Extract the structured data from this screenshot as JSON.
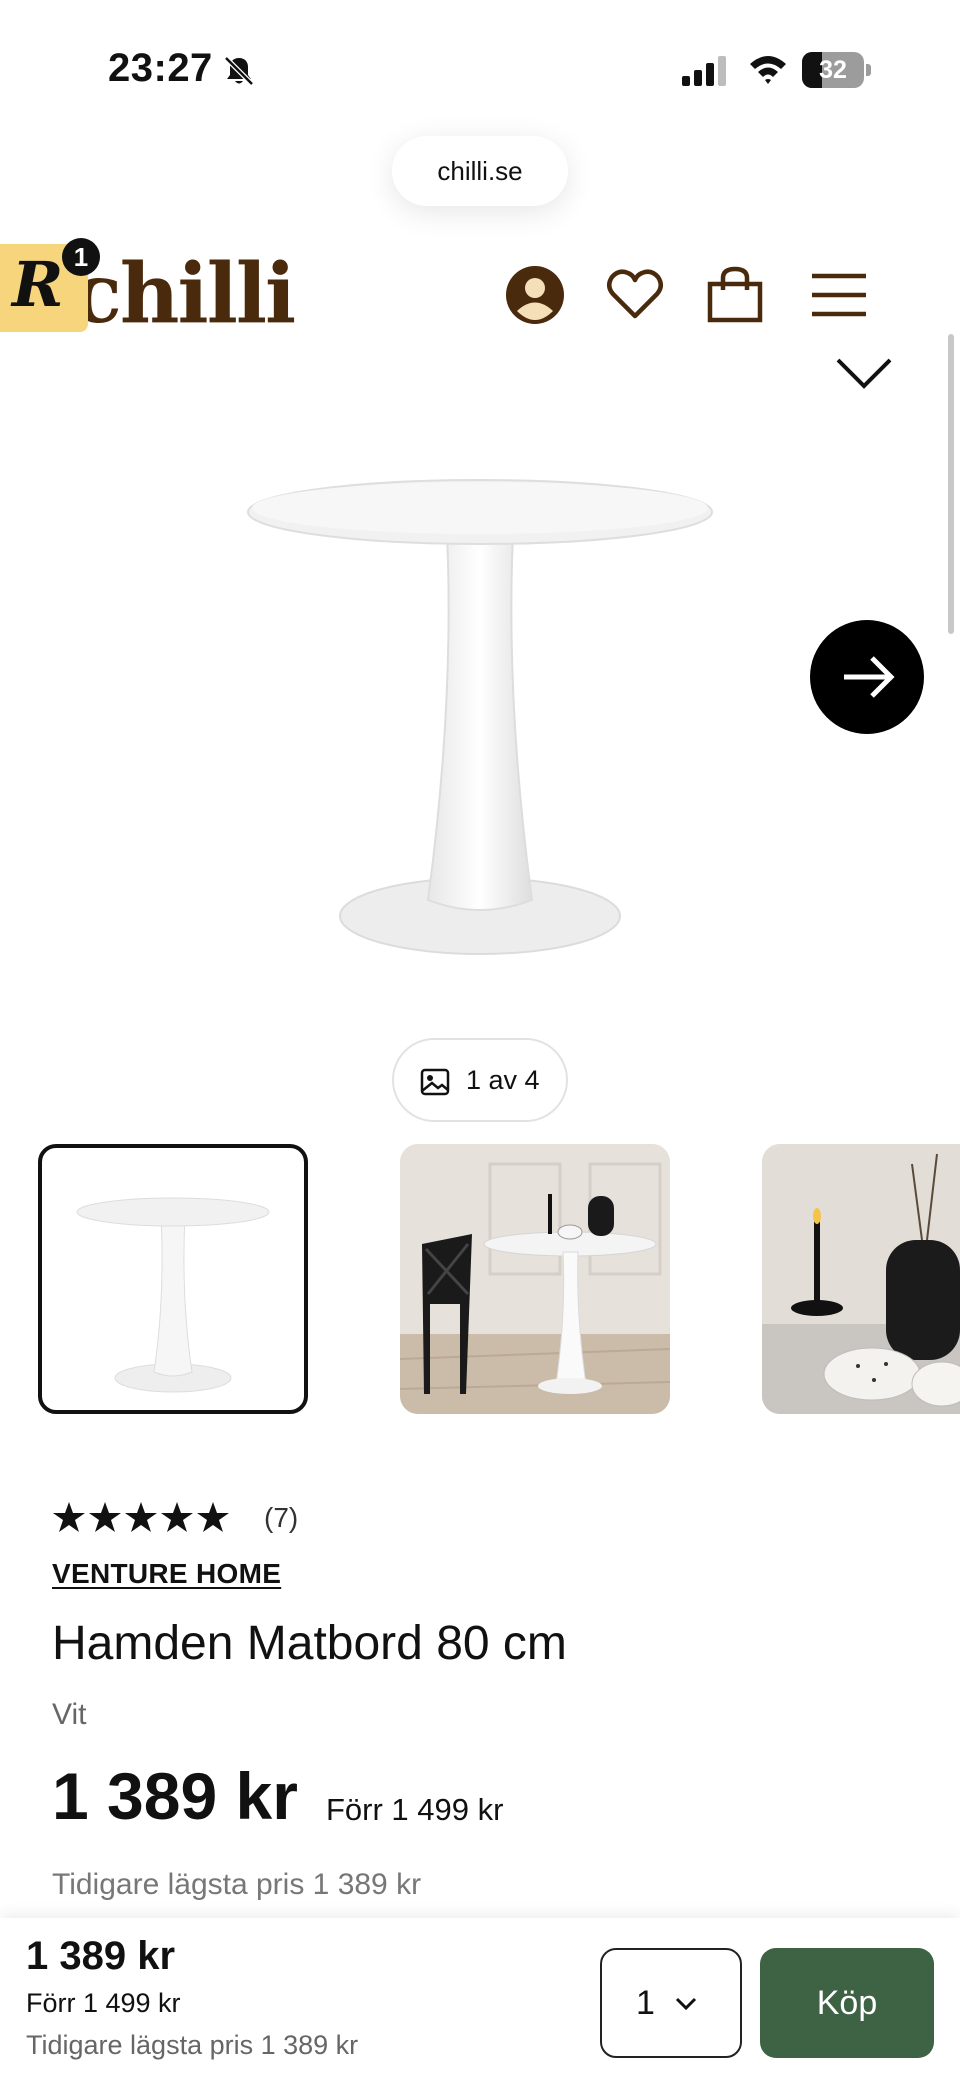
{
  "status_bar": {
    "time": "23:27",
    "battery_percent": "32",
    "battery_level": 0.32
  },
  "browser": {
    "url": "chilli.se"
  },
  "header": {
    "logo_text": "chilli",
    "reward_badge_letter": "R",
    "reward_badge_count": "1",
    "icons": [
      "account-icon",
      "heart-icon",
      "bag-icon",
      "menu-icon"
    ]
  },
  "gallery": {
    "counter": "1 av 4",
    "thumbnails": [
      "table-white",
      "table-with-chair",
      "table-closeup"
    ],
    "active_index": 0
  },
  "product": {
    "rating": 5,
    "review_count": "(7)",
    "brand": "VENTURE HOME",
    "title": "Hamden Matbord 80 cm",
    "color": "Vit",
    "price": "1 389 kr",
    "before_price": "Förr 1 499 kr",
    "lowest_price": "Tidigare lägsta pris 1 389 kr"
  },
  "sticky_bar": {
    "price": "1 389 kr",
    "before_price": "Förr 1 499 kr",
    "lowest_price": "Tidigare lägsta pris 1 389 kr",
    "quantity": "1",
    "buy_label": "Köp"
  },
  "colors": {
    "brand_brown": "#4a2a0c",
    "reward_yellow": "#f7d57c",
    "buy_green": "#3d6244"
  }
}
